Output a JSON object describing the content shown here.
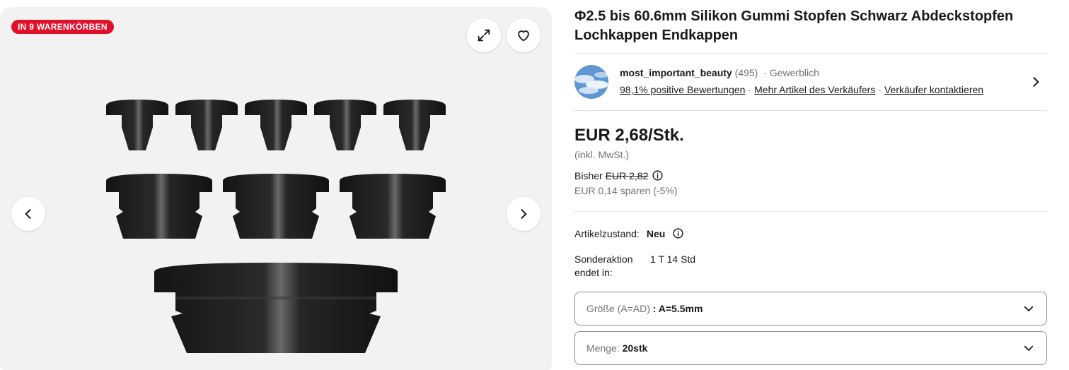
{
  "gallery": {
    "badge": "IN 9 WARENKÖRBEN",
    "icons": {
      "expand": "expand-icon",
      "favorite": "heart-icon",
      "previous": "chevron-left-icon",
      "next": "chevron-right-icon"
    }
  },
  "product": {
    "title": "Φ2.5 bis 60.6mm Silikon Gummi Stopfen Schwarz Abdeckstopfen Lochkappen Endkappen"
  },
  "seller": {
    "name": "most_important_beauty",
    "feedback_count": "(495)",
    "type": "Gewerblich",
    "positive_rating": "98,1% positive Bewertungen",
    "more_items": "Mehr Artikel des Verkäufers",
    "contact": "Verkäufer kontaktieren"
  },
  "pricing": {
    "price": "EUR 2,68/Stk.",
    "vat_note": "(inkl. MwSt.)",
    "was_label": "Bisher",
    "was_price": "EUR 2,82",
    "savings": "EUR 0,14 sparen (-5%)"
  },
  "condition": {
    "label": "Artikelzustand:",
    "value": "Neu"
  },
  "promotion": {
    "label": "Sonderaktion endet in:",
    "value": "1 T 14 Std"
  },
  "variations": {
    "size_label": "Größe (A=AD)",
    "size_value": ": A=5.5mm",
    "quantity_label": "Menge:",
    "quantity_value": "20stk"
  },
  "colors": {
    "badge": "#e0102a",
    "text": "#191919",
    "muted": "#707070",
    "gallery_bg": "#f2f2f2"
  }
}
